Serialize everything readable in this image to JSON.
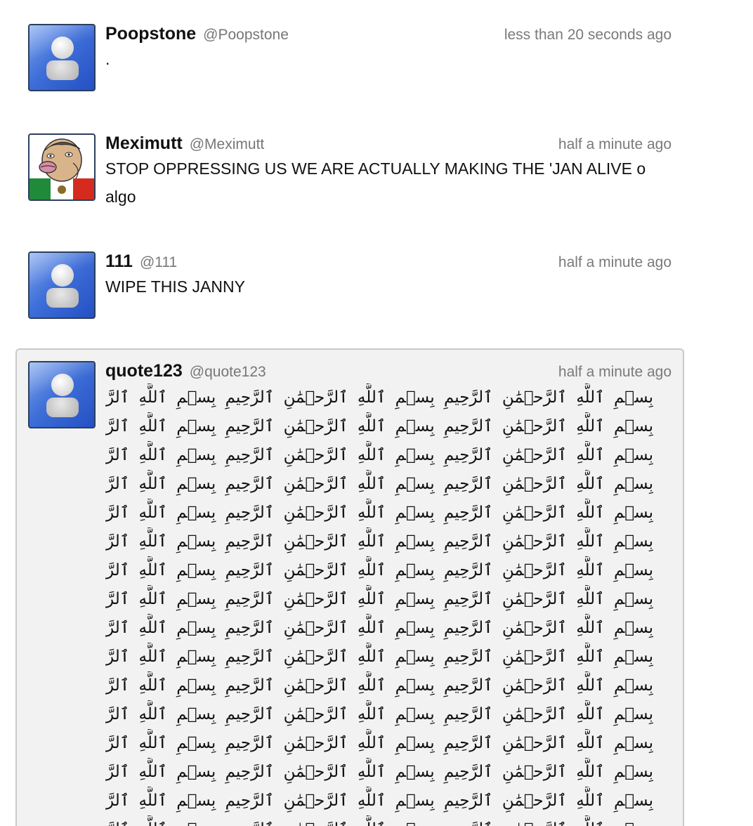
{
  "posts": [
    {
      "name": "Poopstone",
      "handle": "@Poopstone",
      "time": "less than 20 seconds ago",
      "text": ".",
      "avatar": "default-avatar-icon"
    },
    {
      "name": "Meximutt",
      "handle": "@Meximutt",
      "time": "half a minute ago",
      "text": "STOP OPPRESSING US WE ARE ACTUALLY MAKING THE 'JAN ALIVE o algo",
      "avatar": "cartoon-mexican-flag-avatar"
    },
    {
      "name": "111",
      "handle": "@111",
      "time": "half a minute ago",
      "text": "WIPE THIS JANNY",
      "avatar": "default-avatar-icon"
    },
    {
      "name": "quote123",
      "handle": "@quote123",
      "time": "half a minute ago",
      "avatar": "default-avatar-icon",
      "arabic_phrase": "بِسۡمِ ٱللَّهِ ٱلرَّحۡمَٰنِ ٱلرَّحِيمِ",
      "arabic_repeat_per_line": 5,
      "arabic_line_count": 16
    }
  ],
  "colors": {
    "avatar_blue": "#3f6fd8",
    "highlight_bg": "#f2f2f2",
    "time_gray": "#7a7a7a"
  }
}
